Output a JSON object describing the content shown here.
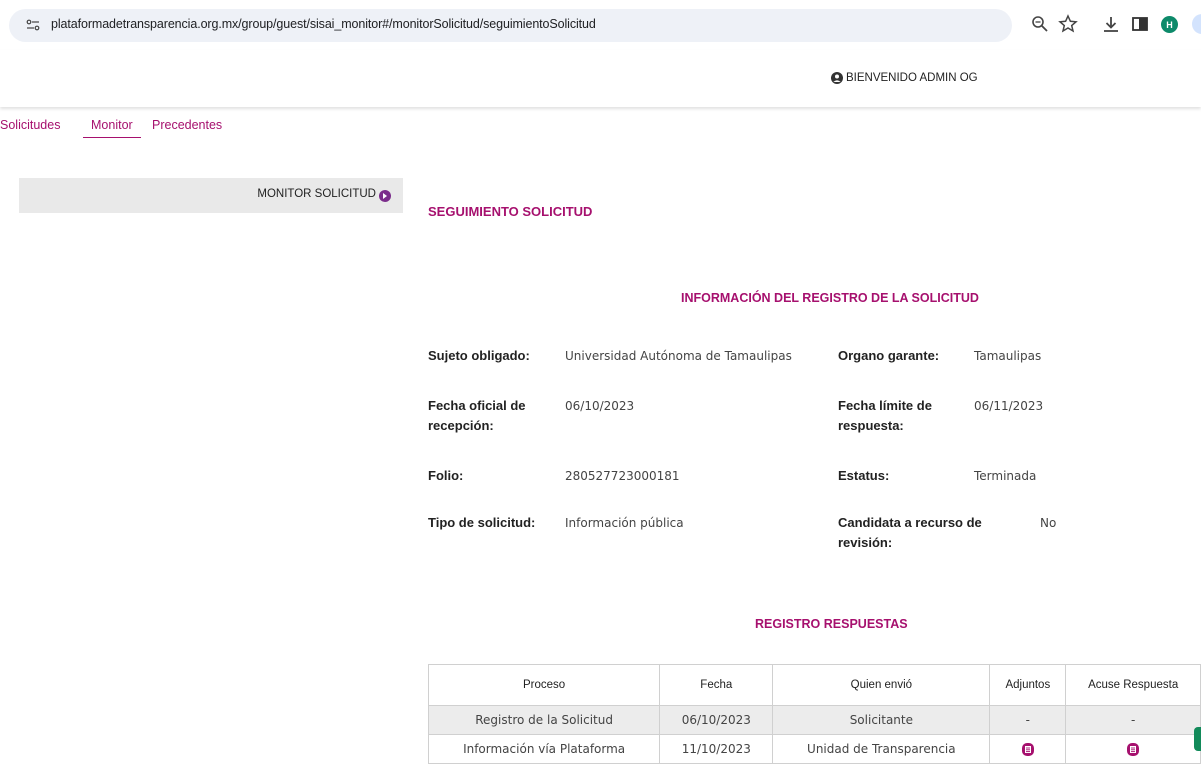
{
  "browser": {
    "url": "plataformadetransparencia.org.mx/group/guest/sisai_monitor#/monitorSolicitud/seguimientoSolicitud",
    "profile_initial": "H"
  },
  "header": {
    "welcome": "BIENVENIDO ADMIN OG"
  },
  "nav": {
    "tabs": [
      "Solicitudes",
      "Monitor",
      "Precedentes"
    ],
    "active": "Monitor"
  },
  "sidebar": {
    "item_label": "MONITOR SOLICITUD"
  },
  "main": {
    "title": "SEGUIMIENTO SOLICITUD",
    "info_title": "INFORMACIÓN DEL REGISTRO DE LA SOLICITUD",
    "fields": {
      "sujeto_label": "Sujeto obligado:",
      "sujeto_value": "Universidad Autónoma de Tamaulipas",
      "organo_label": "Organo garante:",
      "organo_value": "Tamaulipas",
      "fecha_oficial_label": "Fecha oficial de recepción:",
      "fecha_oficial_value": "06/10/2023",
      "fecha_limite_label": "Fecha límite de respuesta:",
      "fecha_limite_value": "06/11/2023",
      "folio_label": "Folio:",
      "folio_value": "280527723000181",
      "estatus_label": "Estatus:",
      "estatus_value": "Terminada",
      "tipo_label": "Tipo de solicitud:",
      "tipo_value": "Información pública",
      "candidata_label": "Candidata a recurso de revisión:",
      "candidata_value": "No"
    },
    "responses_title": "REGISTRO RESPUESTAS",
    "table": {
      "headers": [
        "Proceso",
        "Fecha",
        "Quien envió",
        "Adjuntos",
        "Acuse Respuesta"
      ],
      "rows": [
        {
          "proceso": "Registro de la Solicitud",
          "fecha": "06/10/2023",
          "quien": "Solicitante",
          "adjuntos": "-",
          "acuse": "-"
        },
        {
          "proceso": "Información vía Plataforma",
          "fecha": "11/10/2023",
          "quien": "Unidad de Transparencia",
          "adjuntos_icon": "document-icon",
          "acuse_icon": "document-icon"
        }
      ]
    }
  },
  "colors": {
    "accent": "#a6106e",
    "sidebar_bg": "#e9e9e9",
    "row_gray": "#ececec"
  }
}
